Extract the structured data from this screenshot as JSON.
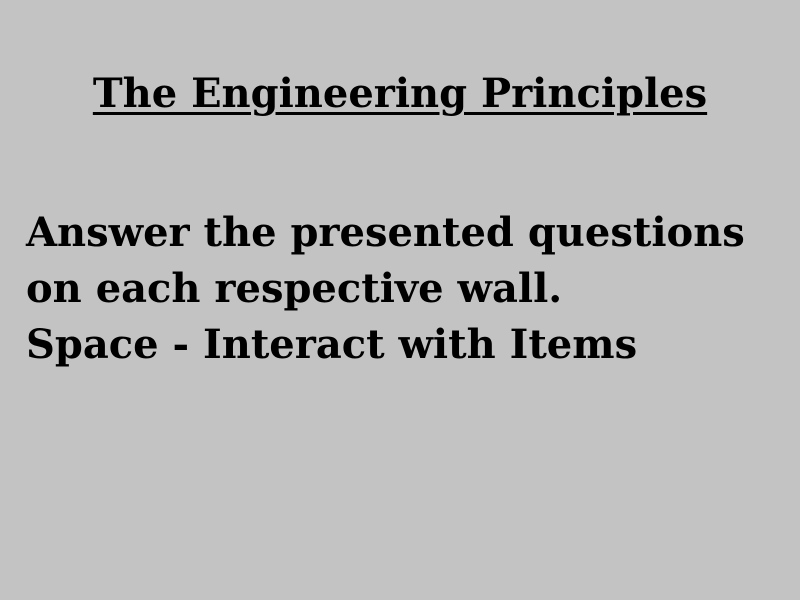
{
  "title": "The Engineering Principles",
  "instructions": {
    "line1": "Answer the presented questions",
    "line2": "on each respective wall.",
    "line3": "Space - Interact with Items"
  },
  "colors": {
    "background": "#c3c3c3",
    "text": "#000000"
  }
}
